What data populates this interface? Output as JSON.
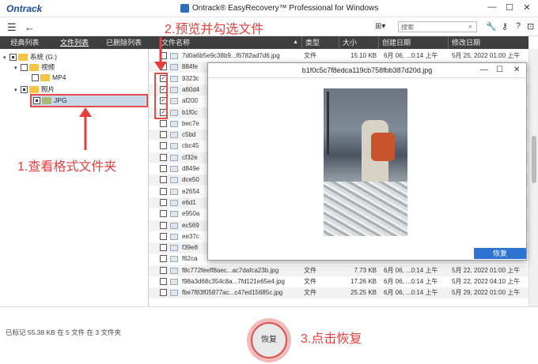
{
  "app": {
    "logo": "Ontrack",
    "title": "Ontrack® EasyRecovery™ Professional for Windows",
    "controls": [
      "—",
      "☐",
      "✕"
    ]
  },
  "toolbar": {
    "menu_icon": "☰",
    "back_icon": "←",
    "view_icon": "⊞▾",
    "search_placeholder": "搜索",
    "icons": [
      "wrench-icon",
      "key-icon",
      "help-icon",
      "cart-icon"
    ]
  },
  "left": {
    "tabs": [
      "经典列表",
      "文件列表",
      "已删除列表"
    ],
    "tree": [
      {
        "exp": "▾",
        "label": "系统 (G:)",
        "check": "part"
      },
      {
        "exp": "▾",
        "label": "视频",
        "check": "none"
      },
      {
        "exp": "",
        "label": "MP4",
        "check": "none"
      },
      {
        "exp": "▾",
        "label": "照片",
        "check": "part"
      },
      {
        "exp": "",
        "label": "JPG",
        "check": "part"
      }
    ]
  },
  "files": {
    "headers": [
      "文件名称",
      "类型",
      "大小",
      "创建日期",
      "修改日期"
    ],
    "rows": [
      {
        "name": "7d0a6b5e9c38b9...f6782ad7d6.jpg",
        "type": "文件",
        "size": "15.10 KB",
        "created": "6月 06, ...0:14 上午",
        "modified": "5月 25, 2022 01:00 上午",
        "checked": false
      },
      {
        "name": "884fe",
        "type": "",
        "size": "",
        "created": "",
        "modified": "",
        "checked": false
      },
      {
        "name": "9323c",
        "type": "",
        "size": "",
        "created": "",
        "modified": "",
        "checked": true
      },
      {
        "name": "a60d4",
        "type": "",
        "size": "",
        "created": "",
        "modified": "",
        "checked": true
      },
      {
        "name": "af200",
        "type": "",
        "size": "",
        "created": "",
        "modified": "",
        "checked": true
      },
      {
        "name": "b1f0c",
        "type": "",
        "size": "",
        "created": "",
        "modified": "",
        "checked": true
      },
      {
        "name": "bec7e",
        "type": "",
        "size": "",
        "created": "",
        "modified": "",
        "checked": false
      },
      {
        "name": "c5bd",
        "type": "",
        "size": "",
        "created": "",
        "modified": "",
        "checked": false
      },
      {
        "name": "cbc45",
        "type": "",
        "size": "",
        "created": "",
        "modified": "",
        "checked": false
      },
      {
        "name": "cf32e",
        "type": "",
        "size": "",
        "created": "",
        "modified": "",
        "checked": false
      },
      {
        "name": "d849e",
        "type": "",
        "size": "",
        "created": "",
        "modified": "",
        "checked": false
      },
      {
        "name": "dce50",
        "type": "",
        "size": "",
        "created": "",
        "modified": "",
        "checked": false
      },
      {
        "name": "e2654",
        "type": "",
        "size": "",
        "created": "",
        "modified": "",
        "checked": false
      },
      {
        "name": "e6d1",
        "type": "",
        "size": "",
        "created": "",
        "modified": "",
        "checked": false
      },
      {
        "name": "e950a",
        "type": "",
        "size": "",
        "created": "",
        "modified": "",
        "checked": false
      },
      {
        "name": "ec569",
        "type": "",
        "size": "",
        "created": "",
        "modified": "",
        "checked": false
      },
      {
        "name": "ee37c",
        "type": "",
        "size": "",
        "created": "",
        "modified": "",
        "checked": false
      },
      {
        "name": "f39e8",
        "type": "",
        "size": "",
        "created": "",
        "modified": "",
        "checked": false
      },
      {
        "name": "f62ca",
        "type": "",
        "size": "",
        "created": "",
        "modified": "",
        "checked": false
      },
      {
        "name": "f8c772feeff8aec...ac7dafca23b.jpg",
        "type": "文件",
        "size": "7.73 KB",
        "created": "6月 06, ...0:14 上午",
        "modified": "5月 22, 2022 01:00 上午",
        "checked": false
      },
      {
        "name": "f98a3d68c354c8a...7fd121e65e4.jpg",
        "type": "文件",
        "size": "17.26 KB",
        "created": "6月 06, ...0:14 上午",
        "modified": "5月 22, 2022 04:10 上午",
        "checked": false
      },
      {
        "name": "fbe7f83f05877ac...c47ed15685c.jpg",
        "type": "文件",
        "size": "25.25 KB",
        "created": "6月 06, ...0:14 上午",
        "modified": "5月 29, 2022 01:00 上午",
        "checked": false
      }
    ]
  },
  "preview": {
    "title": "b1f0c5c7f8edca119cb758fbb387d20d.jpg",
    "controls": [
      "—",
      "☐",
      "✕"
    ],
    "recover_label": "恢复"
  },
  "bottom": {
    "status": "已标记 55.38 KB 在 5 文件 在 3 文件夹",
    "recover_label": "恢复"
  },
  "annotations": {
    "step1": "1.查看格式文件夹",
    "step2": "2.预览并勾选文件",
    "step3": "3.点击恢复",
    "color": "#e53e3e"
  }
}
